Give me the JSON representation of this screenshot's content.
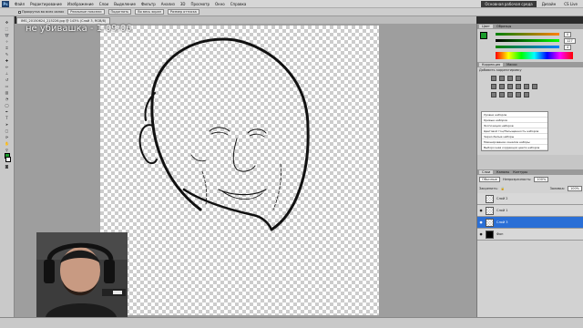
{
  "menubar": {
    "items": [
      "Файл",
      "Редактирование",
      "Изображение",
      "Слои",
      "Выделение",
      "Фильтр",
      "Анализ",
      "3D",
      "Просмотр",
      "Окно",
      "Справка"
    ],
    "workspace_label": "Основная рабочая среда",
    "design_label": "Дизайн",
    "cs_live": "CS Live"
  },
  "options": {
    "scroll_all": "Прокрутка во всех окнах",
    "actual_pixels": "Реальные пиксели",
    "fit_screen": "Подогнать",
    "fill_screen": "Во весь экран",
    "print_size": "Размер оттиска"
  },
  "document": {
    "tab_label": "IMG_20150624_215226.jpg @ 143% (Слой 3, RGB/8)",
    "watermark": "не убивашка - 1-09:06"
  },
  "color_panel": {
    "tabs": [
      "Цвет",
      "Образцы"
    ],
    "r_value": "0",
    "g_value": "127",
    "b_value": "4"
  },
  "adjustments": {
    "tabs": [
      "Коррекция",
      "Маски"
    ],
    "title": "Добавить корректировку",
    "presets": [
      "Уровни наборов",
      "Кривые наборов",
      "Экспозиция наборов",
      "Цветовой тон/Насыщенность наборов",
      "Черно-белые наборы",
      "Микширование каналов наборы",
      "Выборочная коррекция цвета наборов"
    ]
  },
  "layers": {
    "tabs": [
      "Слои",
      "Каналы",
      "Контуры"
    ],
    "blend_mode": "Обычные",
    "opacity_label": "Непрозрачность:",
    "opacity": "100%",
    "lock_label": "Закрепить:",
    "fill_label": "Заливка:",
    "fill": "100%",
    "items": [
      {
        "name": "Слой 2",
        "visible": false,
        "active": false
      },
      {
        "name": "Слой 1",
        "visible": true,
        "active": false
      },
      {
        "name": "Слой 3",
        "visible": true,
        "active": true
      },
      {
        "name": "Фон",
        "visible": true,
        "active": false
      }
    ]
  },
  "colors": {
    "foreground": "#1b9c2c",
    "active_layer": "#2a6fd6",
    "app_chrome": "#c9c9c9"
  }
}
